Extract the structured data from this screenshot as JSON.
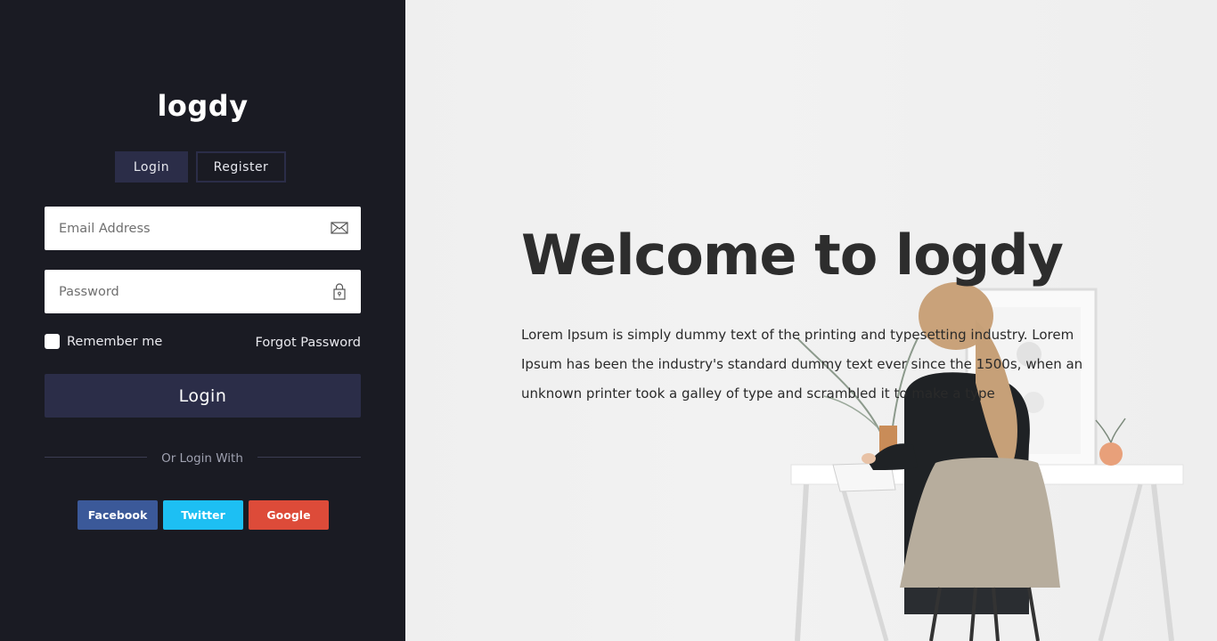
{
  "brand": {
    "logo_text": "logdy"
  },
  "tabs": {
    "login_label": "Login",
    "register_label": "Register"
  },
  "form": {
    "email_placeholder": "Email Address",
    "password_placeholder": "Password",
    "remember_label": "Remember me",
    "forgot_label": "Forgot Password",
    "submit_label": "Login"
  },
  "divider": {
    "text": "Or Login With"
  },
  "social": {
    "facebook_label": "Facebook",
    "twitter_label": "Twitter",
    "google_label": "Google",
    "colors": {
      "facebook": "#3b5999",
      "twitter": "#1dbff3",
      "google": "#dd4b39"
    }
  },
  "hero": {
    "title": "Welcome to logdy",
    "description": "Lorem Ipsum is simply dummy text of the printing and typesetting industry. Lorem Ipsum has been the industry's standard dummy text ever since the 1500s, when an unknown printer took a galley of type and scrambled it to make a type"
  },
  "icons": {
    "email": "envelope-icon",
    "password": "lock-icon"
  },
  "colors": {
    "panel_bg": "#1a1b23",
    "accent": "#2b2d48"
  }
}
